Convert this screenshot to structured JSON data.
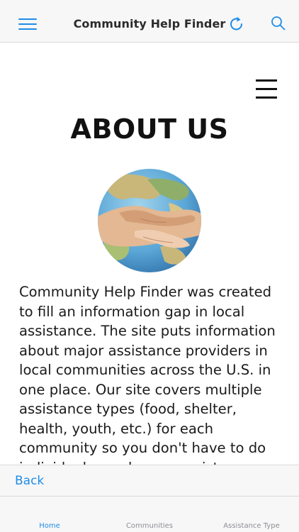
{
  "header": {
    "title": "Community Help Finder",
    "menu_icon": "hamburger-menu-icon",
    "refresh_icon": "refresh-icon",
    "search_icon": "search-icon",
    "accent_color": "#1f8ce6"
  },
  "page": {
    "menu_icon": "hamburger-menu-icon",
    "heading": "ABOUT US",
    "image": "handshake-globe-image",
    "paragraph": "Community Help Finder was created to fill an information gap in local assistance.  The site puts information about major assistance providers in local communities across the U.S. in one place.  Our site covers multiple assistance types (food, shelter, health, youth, etc.) for each community so you don't have to do individual searches on assistance types."
  },
  "footer": {
    "back_label": "Back"
  },
  "tabs": [
    {
      "label": "Home",
      "active": true
    },
    {
      "label": "Communities",
      "active": false
    },
    {
      "label": "Assistance Type",
      "active": false
    }
  ]
}
